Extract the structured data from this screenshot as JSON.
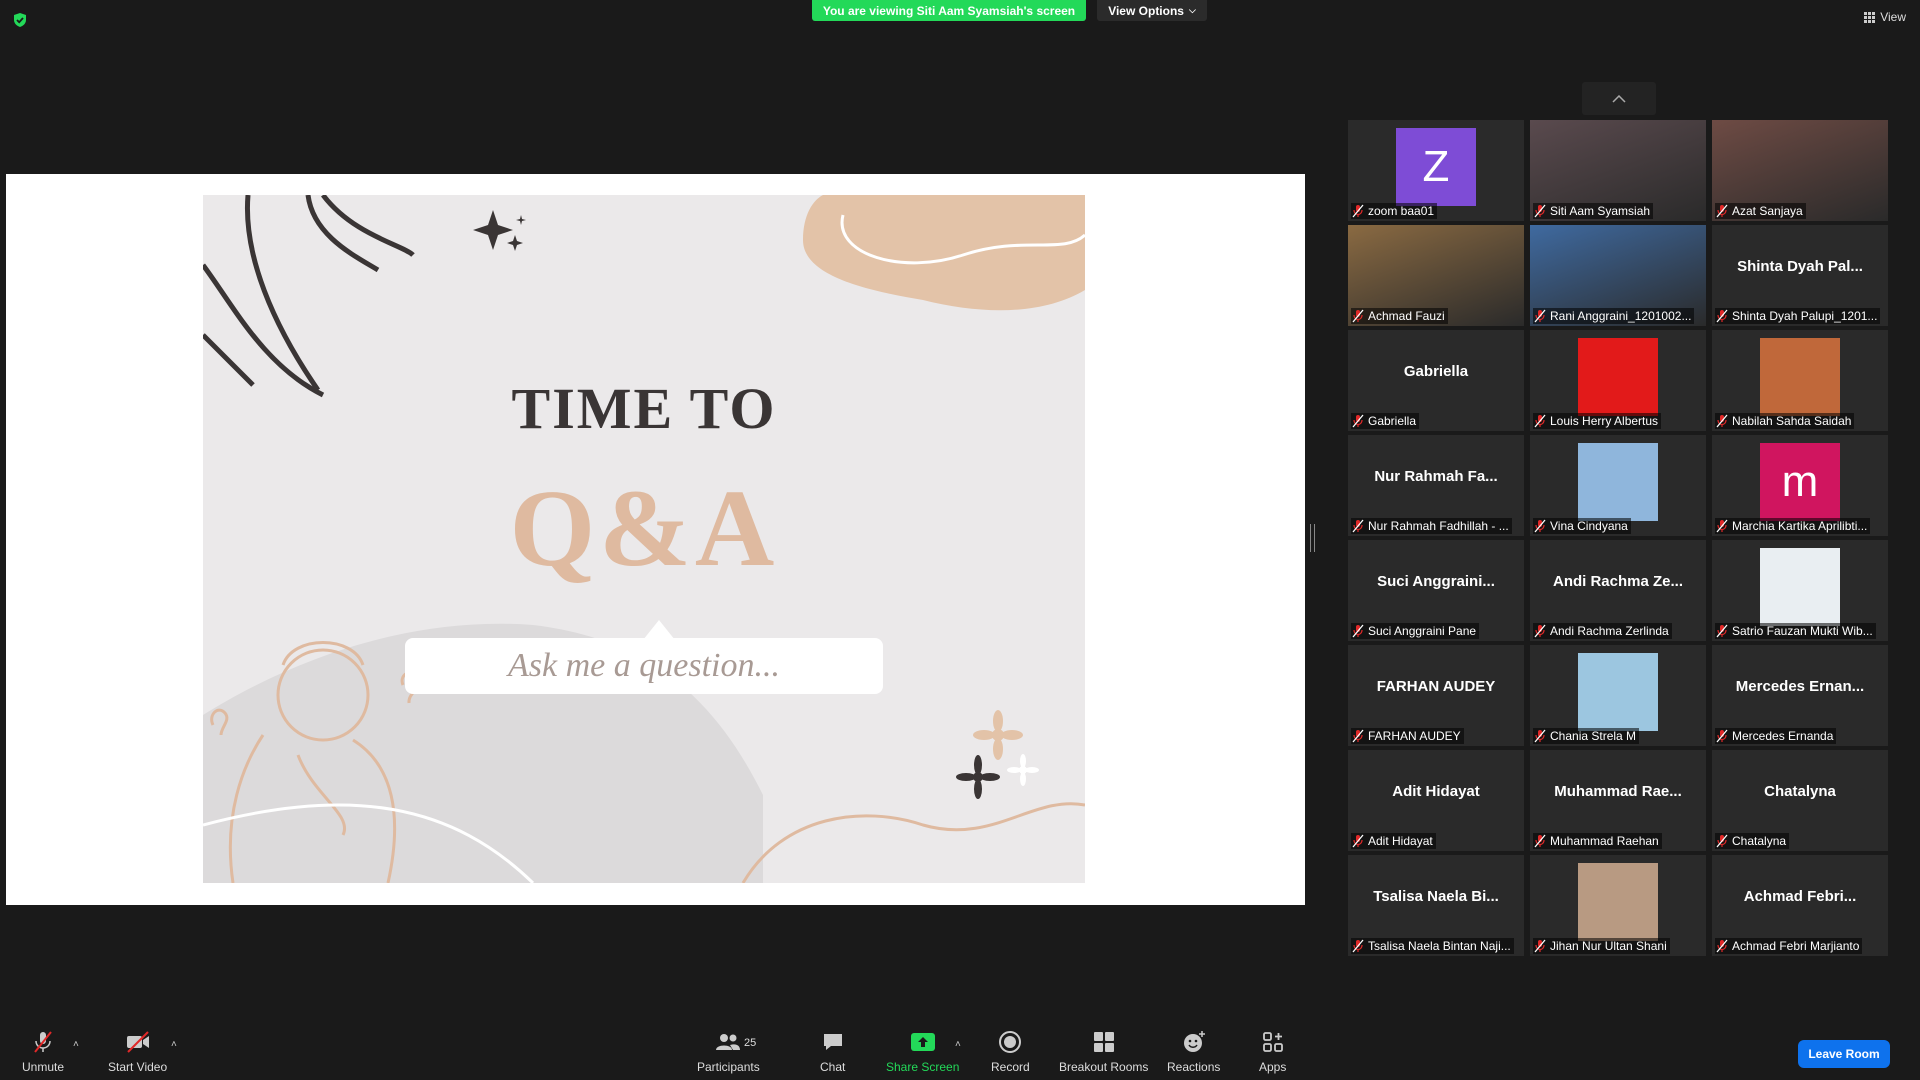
{
  "banner": {
    "text": "You are viewing Siti Aam Syamsiah's screen"
  },
  "view_options": {
    "label": "View Options"
  },
  "view_button": {
    "label": "View"
  },
  "slide": {
    "title": "TIME TO",
    "subtitle": "Q&A",
    "prompt": "Ask me a question..."
  },
  "participants": [
    {
      "display": "",
      "label": "zoom baa01",
      "avatar": "letter",
      "letter": "Z",
      "color": "#7e4cd6"
    },
    {
      "display": "",
      "label": "Siti Aam Syamsiah",
      "avatar": "video",
      "color": "#5a4a4e"
    },
    {
      "display": "",
      "label": "Azat Sanjaya",
      "avatar": "video",
      "color": "#6e4b44",
      "active": true
    },
    {
      "display": "",
      "label": "Achmad Fauzi",
      "avatar": "video",
      "color": "#8a6a42"
    },
    {
      "display": "",
      "label": "Rani Anggraini_1201002...",
      "avatar": "video",
      "color": "#3f6aa0"
    },
    {
      "display": "Shinta Dyah Pal...",
      "label": "Shinta Dyah Palupi_1201...",
      "avatar": "none"
    },
    {
      "display": "Gabriella",
      "label": "Gabriella",
      "avatar": "none"
    },
    {
      "display": "",
      "label": "Louis Herry Albertus",
      "avatar": "photo",
      "color": "#e21a1a"
    },
    {
      "display": "",
      "label": "Nabilah Sahda Saidah",
      "avatar": "photo",
      "color": "#c0683a"
    },
    {
      "display": "Nur Rahmah Fa...",
      "label": "Nur Rahmah Fadhillah - ...",
      "avatar": "none"
    },
    {
      "display": "",
      "label": "Vina Cindyana",
      "avatar": "photo",
      "color": "#8fb6dc"
    },
    {
      "display": "",
      "label": "Marchia Kartika Aprilibti...",
      "avatar": "letter",
      "letter": "m",
      "color": "#d0155f"
    },
    {
      "display": "Suci Anggraini...",
      "label": "Suci Anggraini Pane",
      "avatar": "none"
    },
    {
      "display": "Andi Rachma Ze...",
      "label": "Andi Rachma Zerlinda",
      "avatar": "none"
    },
    {
      "display": "",
      "label": "Satrio Fauzan Mukti Wib...",
      "avatar": "photo",
      "color": "#e9eef2"
    },
    {
      "display": "FARHAN AUDEY",
      "label": "FARHAN AUDEY",
      "avatar": "none"
    },
    {
      "display": "",
      "label": "Chania Strela M",
      "avatar": "photo",
      "color": "#9cc6e0"
    },
    {
      "display": "Mercedes Ernan...",
      "label": "Mercedes Ernanda",
      "avatar": "none"
    },
    {
      "display": "Adit Hidayat",
      "label": "Adit Hidayat",
      "avatar": "none"
    },
    {
      "display": "Muhammad Rae...",
      "label": "Muhammad Raehan",
      "avatar": "none"
    },
    {
      "display": "Chatalyna",
      "label": "Chatalyna",
      "avatar": "none"
    },
    {
      "display": "Tsalisa Naela Bi...",
      "label": "Tsalisa Naela Bintan Naji...",
      "avatar": "none"
    },
    {
      "display": "",
      "label": "Jihan Nur Ultan Shani",
      "avatar": "photo",
      "color": "#b89a82"
    },
    {
      "display": "Achmad Febri...",
      "label": "Achmad Febri Marjianto",
      "avatar": "none"
    }
  ],
  "toolbar": {
    "unmute": "Unmute",
    "start_video": "Start Video",
    "participants": "Participants",
    "participants_count": "25",
    "chat": "Chat",
    "share_screen": "Share Screen",
    "record": "Record",
    "breakout_rooms": "Breakout Rooms",
    "reactions": "Reactions",
    "apps": "Apps",
    "leave_room": "Leave Room"
  },
  "colors": {
    "banner": "#23d959",
    "leave": "#0e72ed",
    "active_speaker": "#f0f65a",
    "share": "#23d959"
  }
}
